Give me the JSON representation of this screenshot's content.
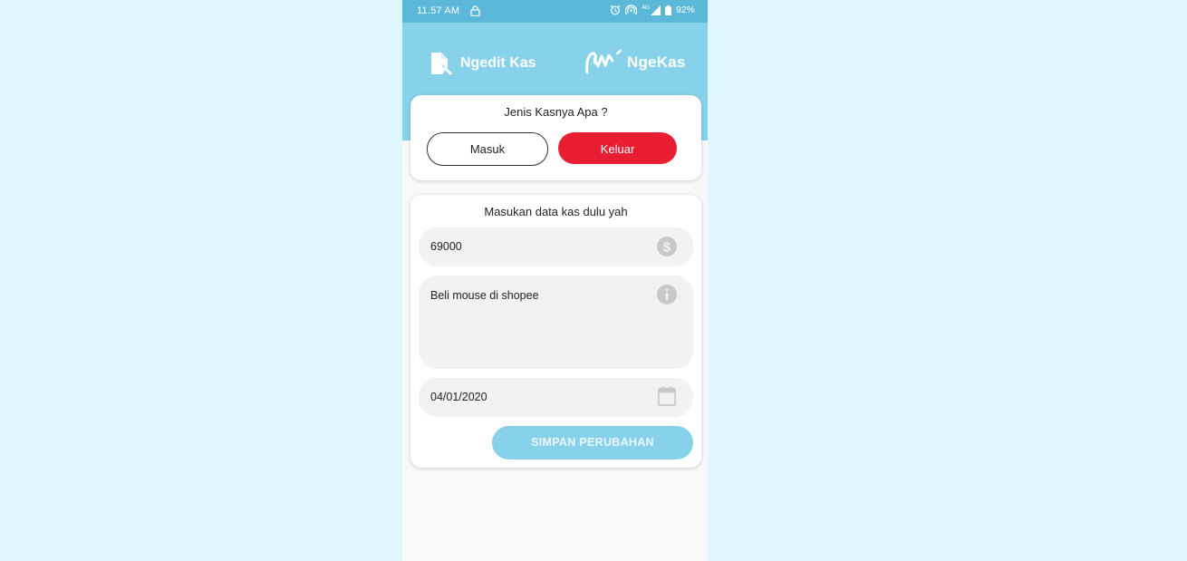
{
  "status_bar": {
    "time": "11.57 AM",
    "network": "4G",
    "battery": "92%"
  },
  "header": {
    "title": "Ngedit Kas",
    "brand": "NgeKas",
    "icon": "document-edit-icon"
  },
  "type_card": {
    "title": "Jenis Kasnya Apa ?",
    "options": [
      {
        "label": "Masuk",
        "selected": false
      },
      {
        "label": "Keluar",
        "selected": true
      }
    ],
    "selected_color": "#e91e32"
  },
  "data_card": {
    "title": "Masukan data kas dulu yah",
    "amount": {
      "value": "69000",
      "icon": "dollar-icon"
    },
    "description": {
      "value": "Beli mouse di shopee",
      "icon": "info-icon"
    },
    "date": {
      "value": "04/01/2020",
      "icon": "calendar-icon"
    },
    "save_label": "SIMPAN PERUBAHAN"
  },
  "colors": {
    "accent": "#87d1ea",
    "status_bar": "#5cb8d8",
    "background": "#dff6fd",
    "danger": "#e91e32"
  }
}
